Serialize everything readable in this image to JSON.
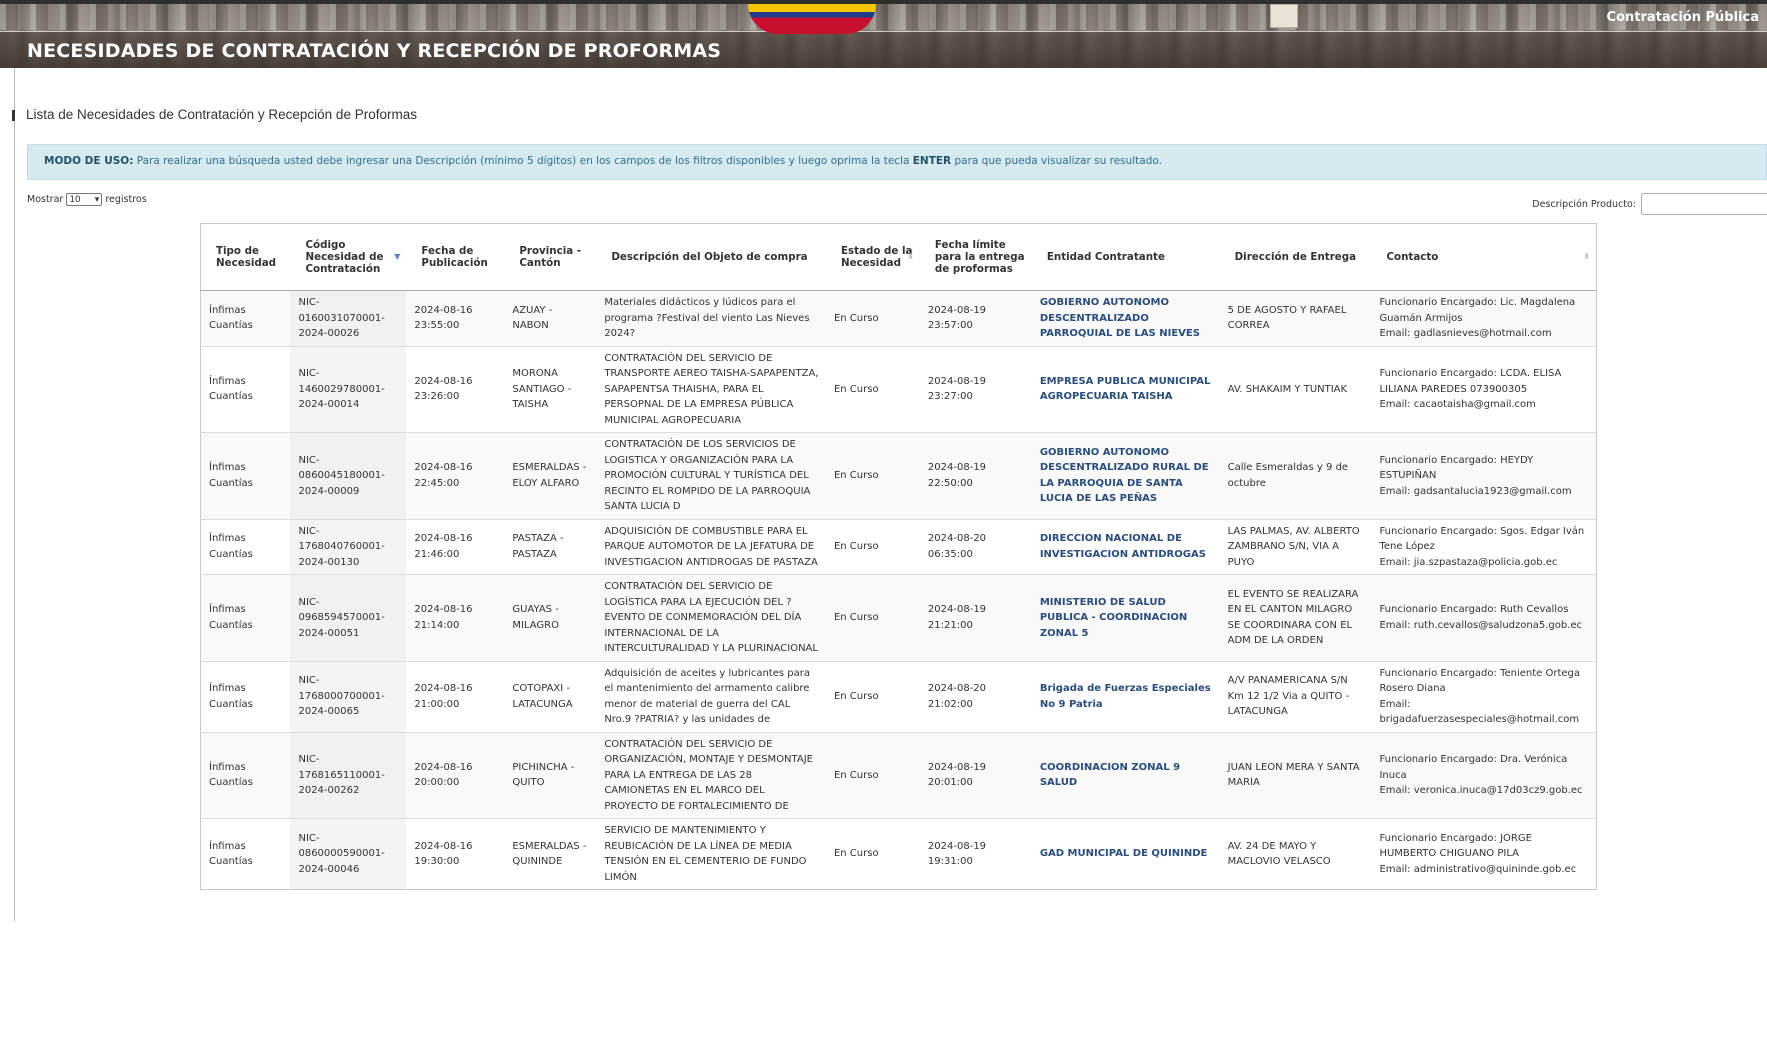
{
  "header": {
    "title": "NECESIDADES DE CONTRATACIÓN Y RECEPCIÓN DE PROFORMAS",
    "brand": "Contratación Pública"
  },
  "section_title": "Lista de Necesidades de Contratación y Recepción de Proformas",
  "info": {
    "label": "MODO DE USO:",
    "text_1": " Para realizar una búsqueda usted debe ingresar una Descripción (mínimo 5 dígitos) en los campos de los filtros disponibles y luego oprima la tecla ",
    "key": "ENTER",
    "text_2": " para que pueda visualizar su resultado."
  },
  "length_menu": {
    "prefix": "Mostrar",
    "selected": "10",
    "suffix": "registros"
  },
  "filter": {
    "label": "Descripción Producto:",
    "value": ""
  },
  "table": {
    "columns": [
      "Tipo de Necesidad",
      "Código Necesidad de Contratación",
      "Fecha de Publicación",
      "Provincia - Cantón",
      "Descripción del Objeto de compra",
      "Estado de la Necesidad",
      "Fecha límite para la entrega de proformas",
      "Entidad Contratante",
      "Dirección de Entrega",
      "Contacto"
    ],
    "rows": [
      {
        "tipo": "Ínfimas Cuantías",
        "codigo": "NIC-0160031070001-2024-00026",
        "fecha": "2024-08-16 23:55:00",
        "provincia": "AZUAY - NABON",
        "descripcion": "Materiales didácticos y lúdicos para el programa ?Festival del viento Las Nieves 2024?",
        "estado": "En Curso",
        "fecha_limite": "2024-08-19 23:57:00",
        "entidad": "GOBIERNO AUTONOMO DESCENTRALIZADO PARROQUIAL DE LAS NIEVES",
        "direccion": "5 DE AGOSTO Y RAFAEL CORREA",
        "contacto": "Funcionario Encargado: Lic. Magdalena Guamán Armijos",
        "email": "Email: gadlasnieves@hotmail.com"
      },
      {
        "tipo": "Ínfimas Cuantías",
        "codigo": "NIC-1460029780001-2024-00014",
        "fecha": "2024-08-16 23:26:00",
        "provincia": "MORONA SANTIAGO - TAISHA",
        "descripcion": "CONTRATACIÓN DEL SERVICIO DE TRANSPORTE AEREO TAISHA-SAPAPENTZA, SAPAPENTSA THAISHA, PARA EL PERSOPNAL DE LA EMPRESA PÚBLICA MUNICIPAL AGROPECUARIA",
        "estado": "En Curso",
        "fecha_limite": "2024-08-19 23:27:00",
        "entidad": "EMPRESA PUBLICA MUNICIPAL AGROPECUARIA TAISHA",
        "direccion": "AV. SHAKAIM Y TUNTIAK",
        "contacto": "Funcionario Encargado: LCDA. ELISA LILIANA PAREDES 073900305",
        "email": "Email: cacaotaisha@gmail.com"
      },
      {
        "tipo": "Ínfimas Cuantías",
        "codigo": "NIC-0860045180001-2024-00009",
        "fecha": "2024-08-16 22:45:00",
        "provincia": "ESMERALDAS - ELOY ALFARO",
        "descripcion": "CONTRATACIÓN DE LOS SERVICIOS DE LOGISTICA Y ORGANIZACIÓN PARA LA PROMOCIÓN CULTURAL Y TURÍSTICA DEL RECINTO EL ROMPIDO DE LA PARROQUIA SANTA LUCIA D",
        "estado": "En Curso",
        "fecha_limite": "2024-08-19 22:50:00",
        "entidad": "GOBIERNO AUTONOMO DESCENTRALIZADO RURAL DE LA PARROQUIA DE SANTA LUCIA DE LAS PEÑAS",
        "direccion": "Calle Esmeraldas y 9 de octubre",
        "contacto": "Funcionario Encargado: HEYDY ESTUPIÑAN",
        "email": "Email: gadsantalucia1923@gmail.com"
      },
      {
        "tipo": "Ínfimas Cuantías",
        "codigo": "NIC-1768040760001-2024-00130",
        "fecha": "2024-08-16 21:46:00",
        "provincia": "PASTAZA - PASTAZA",
        "descripcion": "ADQUISICIÓN DE COMBUSTIBLE PARA EL PARQUE AUTOMOTOR DE LA JEFATURA DE INVESTIGACION ANTIDROGAS DE PASTAZA",
        "estado": "En Curso",
        "fecha_limite": "2024-08-20 06:35:00",
        "entidad": "DIRECCION NACIONAL DE INVESTIGACION ANTIDROGAS",
        "direccion": "LAS PALMAS, AV. ALBERTO ZAMBRANO S/N, VIA A PUYO",
        "contacto": "Funcionario Encargado: Sgos. Edgar Iván Tene López",
        "email": "Email: jia.szpastaza@policia.gob.ec"
      },
      {
        "tipo": "Ínfimas Cuantías",
        "codigo": "NIC-0968594570001-2024-00051",
        "fecha": "2024-08-16 21:14:00",
        "provincia": "GUAYAS - MILAGRO",
        "descripcion": "CONTRATACIÓN DEL SERVICIO DE LOGÍSTICA PARA LA EJECUCIÓN DEL ? EVENTO DE CONMEMORACIÓN DEL DÍA INTERNACIONAL DE LA INTERCULTURALIDAD Y LA PLURINACIONAL",
        "estado": "En Curso",
        "fecha_limite": "2024-08-19 21:21:00",
        "entidad": "MINISTERIO DE SALUD PUBLICA - COORDINACION ZONAL 5",
        "direccion": "EL EVENTO SE REALIZARA EN EL CANTON MILAGRO SE COORDINARA CON EL ADM DE LA ORDEN",
        "contacto": "Funcionario Encargado: Ruth Cevallos",
        "email": "Email: ruth.cevallos@saludzona5.gob.ec"
      },
      {
        "tipo": "Ínfimas Cuantías",
        "codigo": "NIC-1768000700001-2024-00065",
        "fecha": "2024-08-16 21:00:00",
        "provincia": "COTOPAXI - LATACUNGA",
        "descripcion": "Adquisición de aceites y lubricantes para el mantenimiento del armamento calibre menor de material de guerra del CAL Nro.9 ?PATRIA? y las unidades de",
        "estado": "En Curso",
        "fecha_limite": "2024-08-20 21:02:00",
        "entidad": "Brigada de Fuerzas Especiales No 9 Patria",
        "direccion": "A/V PANAMERICANA S/N Km 12 1/2 Via a QUITO - LATACUNGA",
        "contacto": "Funcionario Encargado: Teniente Ortega Rosero Diana",
        "email": "Email: brigadafuerzasespeciales@hotmail.com"
      },
      {
        "tipo": "Ínfimas Cuantías",
        "codigo": "NIC-1768165110001-2024-00262",
        "fecha": "2024-08-16 20:00:00",
        "provincia": "PICHINCHA - QUITO",
        "descripcion": "CONTRATACIÓN DEL SERVICIO DE ORGANIZACIÓN, MONTAJE Y DESMONTAJE PARA LA ENTREGA DE LAS 28 CAMIONETAS EN EL MARCO DEL PROYECTO DE FORTALECIMIENTO DE",
        "estado": "En Curso",
        "fecha_limite": "2024-08-19 20:01:00",
        "entidad": "COORDINACION ZONAL 9 SALUD",
        "direccion": "JUAN LEON MERA Y SANTA MARIA",
        "contacto": "Funcionario Encargado: Dra. Verónica Inuca",
        "email": "Email: veronica.inuca@17d03cz9.gob.ec"
      },
      {
        "tipo": "Ínfimas Cuantías",
        "codigo": "NIC-0860000590001-2024-00046",
        "fecha": "2024-08-16 19:30:00",
        "provincia": "ESMERALDAS - QUININDE",
        "descripcion": "SERVICIO DE MANTENIMIENTO Y REUBICACIÓN DE LA LÍNEA DE MEDIA TENSIÓN EN EL CEMENTERIO DE FUNDO LIMÓN",
        "estado": "En Curso",
        "fecha_limite": "2024-08-19 19:31:00",
        "entidad": "GAD MUNICIPAL DE QUININDE",
        "direccion": "AV. 24 DE MAYO Y MACLOVIO VELASCO",
        "contacto": "Funcionario Encargado: JORGE HUMBERTO CHIGUANO PILA",
        "email": "Email: administrativo@quininde.gob.ec"
      }
    ]
  }
}
